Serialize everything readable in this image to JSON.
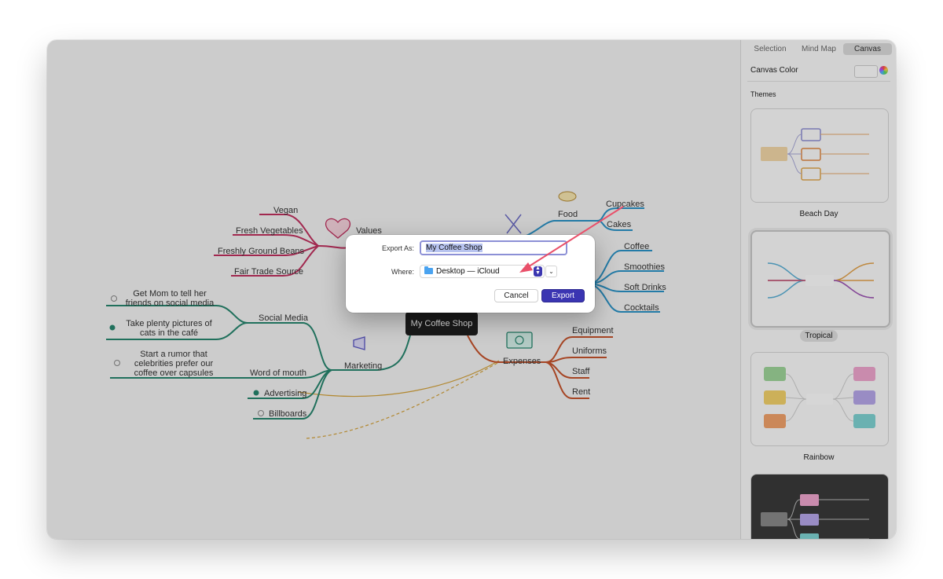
{
  "window": {
    "title": "My Coffee Shop"
  },
  "mindmap": {
    "root": "My Coffee Shop",
    "values": {
      "label": "Values",
      "items": [
        "Vegan",
        "Fresh Vegetables",
        "Freshly Ground Beans",
        "Fair Trade Source"
      ]
    },
    "food": {
      "label": "Food",
      "items": [
        "Cupcakes",
        "Cakes"
      ]
    },
    "drinks": {
      "items": [
        "Coffee",
        "Smoothies",
        "Soft Drinks",
        "Cocktails"
      ]
    },
    "expenses": {
      "label": "Expenses",
      "items": [
        "Equipment",
        "Uniforms",
        "Staff",
        "Rent"
      ]
    },
    "marketing": {
      "label": "Marketing",
      "social_media": "Social Media",
      "word_of_mouth": "Word of mouth",
      "advertising": "Advertising",
      "billboards": "Billboards",
      "tasks": [
        {
          "text": "Get Mom to tell her friends on social media",
          "done": false
        },
        {
          "text": "Take plenty pictures of cats in the café",
          "done": true
        },
        {
          "text": "Start a rumor that celebrities prefer our coffee over capsules",
          "done": false
        }
      ]
    },
    "colors": {
      "values": "#c0305f",
      "food": "#2a93c7",
      "marketing": "#27866e",
      "expenses": "#c6532b",
      "relation": "#d4a23a"
    }
  },
  "inspector": {
    "tabs": [
      "Selection",
      "Mind Map",
      "Canvas"
    ],
    "active_tab": "Canvas",
    "canvas_color_label": "Canvas Color",
    "themes_label": "Themes",
    "themes": [
      {
        "name": "Beach Day",
        "selected": false
      },
      {
        "name": "Tropical",
        "selected": true
      },
      {
        "name": "Rainbow",
        "selected": false
      }
    ]
  },
  "export_dialog": {
    "export_as_label": "Export As:",
    "export_as_value": "My Coffee Shop",
    "where_label": "Where:",
    "where_value": "Desktop — iCloud",
    "cancel_label": "Cancel",
    "export_label": "Export"
  }
}
